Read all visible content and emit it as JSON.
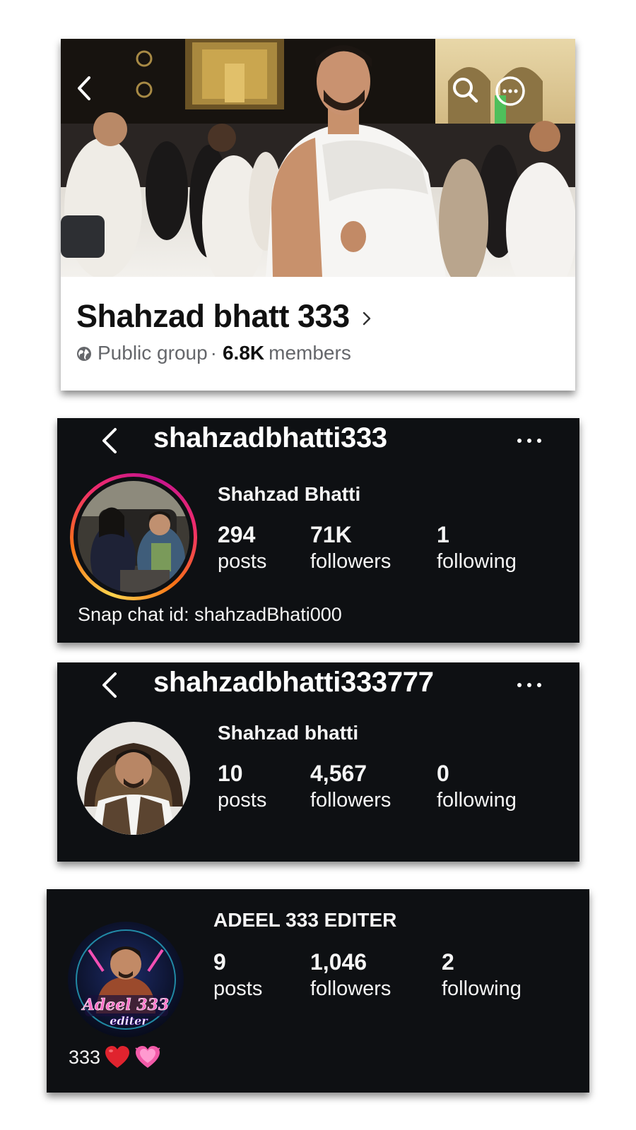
{
  "facebook_group": {
    "title": "Shahzad bhatt 333",
    "privacy": "Public group",
    "separator": "·",
    "member_count": "6.8K",
    "member_label": "members"
  },
  "instagram_profiles": [
    {
      "username": "shahzadbhatti333",
      "display_name": "Shahzad Bhatti",
      "stats": [
        {
          "value": "294",
          "label": "posts"
        },
        {
          "value": "71K",
          "label": "followers"
        },
        {
          "value": "1",
          "label": "following"
        }
      ],
      "bio": "Snap chat id: shahzadBhati000"
    },
    {
      "username": "shahzadbhatti333777",
      "display_name": "Shahzad bhatti",
      "stats": [
        {
          "value": "10",
          "label": "posts"
        },
        {
          "value": "4,567",
          "label": "followers"
        },
        {
          "value": "0",
          "label": "following"
        }
      ]
    },
    {
      "display_name": "ADEEL 333 EDITER",
      "stats": [
        {
          "value": "9",
          "label": "posts"
        },
        {
          "value": "1,046",
          "label": "followers"
        },
        {
          "value": "2",
          "label": "following"
        }
      ],
      "bio": "333",
      "avatar_text": [
        "Adeel 333",
        "editer"
      ]
    }
  ],
  "icons": [
    "back-icon",
    "search-icon",
    "more-options-icon",
    "chevron-right-icon",
    "globe-icon",
    "more-dots-icon",
    "red-heart-emoji",
    "pink-heart-emoji"
  ],
  "colors": {
    "ig_background": "#0e1013",
    "fb_meta_text": "#65676b",
    "story_ring": [
      "#fcd34d",
      "#f97316",
      "#ef2b6d",
      "#c4148f"
    ]
  }
}
